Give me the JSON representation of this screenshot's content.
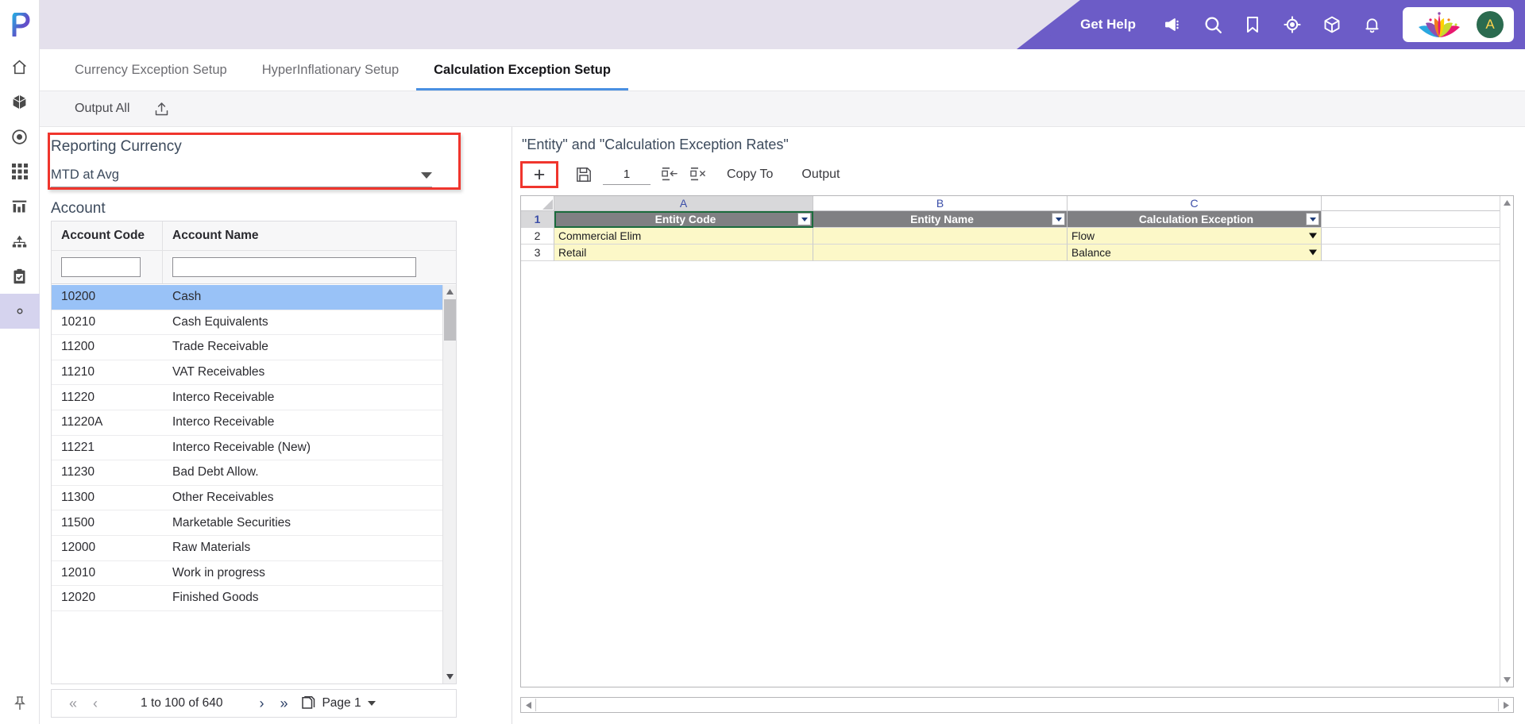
{
  "header": {
    "get_help": "Get Help",
    "icons": [
      "megaphone-icon",
      "search-icon",
      "bookmark-icon",
      "target-icon",
      "cube-icon",
      "bell-icon"
    ],
    "brand_logo": "lotus-logo",
    "avatar_initial": "A",
    "purple": "#6c5cc7",
    "bar_bg": "#e4e0ec"
  },
  "rail": {
    "logo": "p-logo",
    "items": [
      {
        "name": "home-icon",
        "active": false
      },
      {
        "name": "package-icon",
        "active": false
      },
      {
        "name": "target-circle-icon",
        "active": false
      },
      {
        "name": "grid-icon",
        "active": false
      },
      {
        "name": "bar-chart-icon",
        "active": false
      },
      {
        "name": "hierarchy-icon",
        "active": false
      },
      {
        "name": "clipboard-check-icon",
        "active": false
      },
      {
        "name": "gear-icon",
        "active": true
      }
    ],
    "pin": "pin-icon"
  },
  "tabs": [
    {
      "label": "Currency Exception Setup",
      "active": false
    },
    {
      "label": "HyperInflationary Setup",
      "active": false
    },
    {
      "label": "Calculation Exception Setup",
      "active": true
    }
  ],
  "subbar": {
    "output_all": "Output All",
    "upload_icon": "upload-icon"
  },
  "reporting_currency": {
    "title": "Reporting Currency",
    "selected": "MTD at Avg",
    "highlight_color": "#f0352d"
  },
  "account": {
    "title": "Account",
    "columns": [
      "Account Code",
      "Account Name"
    ],
    "filter_code": "",
    "filter_name": "",
    "rows": [
      {
        "code": "10200",
        "name": "Cash",
        "selected": true
      },
      {
        "code": "10210",
        "name": "Cash Equivalents",
        "selected": false
      },
      {
        "code": "11200",
        "name": "Trade Receivable",
        "selected": false
      },
      {
        "code": "11210",
        "name": "VAT Receivables",
        "selected": false
      },
      {
        "code": "11220",
        "name": "Interco Receivable",
        "selected": false
      },
      {
        "code": "11220A",
        "name": "Interco Receivable",
        "selected": false
      },
      {
        "code": "11221",
        "name": "Interco Receivable (New)",
        "selected": false
      },
      {
        "code": "11230",
        "name": "Bad Debt Allow.",
        "selected": false
      },
      {
        "code": "11300",
        "name": "Other Receivables",
        "selected": false
      },
      {
        "code": "11500",
        "name": "Marketable Securities",
        "selected": false
      },
      {
        "code": "12000",
        "name": "Raw Materials",
        "selected": false
      },
      {
        "code": "12010",
        "name": "Work in progress",
        "selected": false
      },
      {
        "code": "12020",
        "name": "Finished Goods",
        "selected": false
      }
    ],
    "pager": {
      "first": "«",
      "prev": "‹",
      "range": "1 to 100 of 640",
      "next": "›",
      "last": "»",
      "copy_icon": "copy-pages-icon",
      "page_label": "Page 1"
    }
  },
  "sheet": {
    "title": "\"Entity\" and \"Calculation Exception Rates\"",
    "toolbar": {
      "add": "+",
      "save_icon": "save-icon",
      "count": "1",
      "insert_row_icon": "insert-row-icon",
      "delete_row_icon": "delete-row-icon",
      "copy_to": "Copy To",
      "output": "Output"
    },
    "column_letters": [
      "A",
      "B",
      "C"
    ],
    "header_row_num": "1",
    "headers": [
      "Entity Code",
      "Entity Name",
      "Calculation Exception"
    ],
    "rows": [
      {
        "num": "2",
        "cells": [
          "Commercial Elim",
          "",
          "Flow"
        ]
      },
      {
        "num": "3",
        "cells": [
          "Retail",
          "",
          "Balance"
        ]
      }
    ],
    "selected_header_index": 0,
    "selection_color": "#1a6b3c",
    "header_bg": "#808083",
    "data_bg": "#fcf8c8"
  }
}
